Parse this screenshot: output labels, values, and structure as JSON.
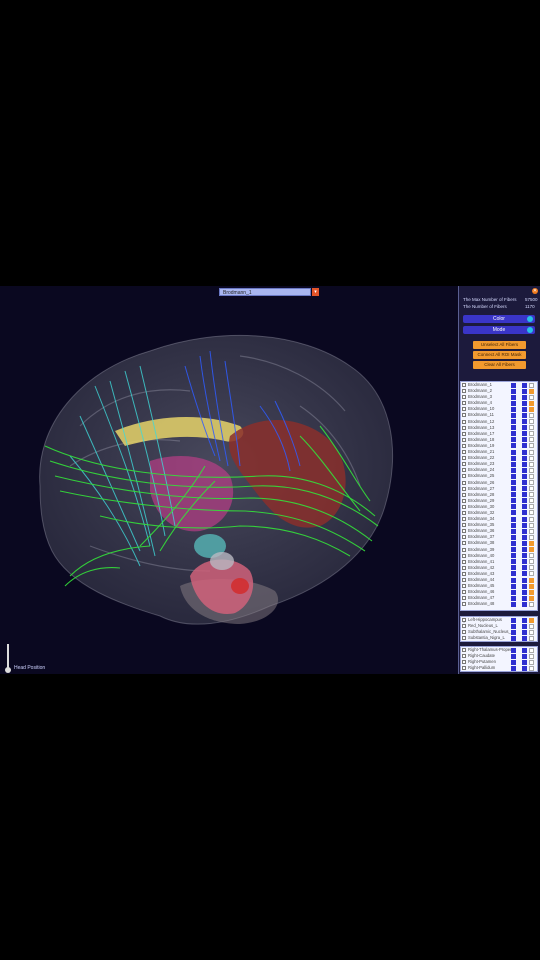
{
  "viewer": {
    "region_selector": {
      "value": "Brodmann_1"
    },
    "head_position_label": "Head Position"
  },
  "panel": {
    "stats": [
      {
        "label": "The Max Number of Fibers",
        "value": "57500"
      },
      {
        "label": "The Number of Fibers",
        "value": "1170"
      }
    ],
    "color_button": "Color",
    "mode_button": "Mode",
    "unselect_all": "Unselect All Fibers",
    "connect_btn": "Connect All ROI Mask",
    "clear_all": "Clear All Fibers",
    "brodmann_rows": [
      {
        "label": "Brodmann_1",
        "checked": false,
        "highlight": false
      },
      {
        "label": "Brodmann_2",
        "checked": false,
        "highlight": true
      },
      {
        "label": "Brodmann_3",
        "checked": false,
        "highlight": false
      },
      {
        "label": "Brodmann_4",
        "checked": false,
        "highlight": true
      },
      {
        "label": "Brodmann_10",
        "checked": false,
        "highlight": true
      },
      {
        "label": "Brodmann_11",
        "checked": false,
        "highlight": false
      },
      {
        "label": "Brodmann_12",
        "checked": false,
        "highlight": false
      },
      {
        "label": "Brodmann_13",
        "checked": false,
        "highlight": false
      },
      {
        "label": "Brodmann_17",
        "checked": false,
        "highlight": false
      },
      {
        "label": "Brodmann_18",
        "checked": false,
        "highlight": false
      },
      {
        "label": "Brodmann_19",
        "checked": false,
        "highlight": false
      },
      {
        "label": "Brodmann_21",
        "checked": false,
        "highlight": false
      },
      {
        "label": "Brodmann_22",
        "checked": false,
        "highlight": false
      },
      {
        "label": "Brodmann_23",
        "checked": false,
        "highlight": false
      },
      {
        "label": "Brodmann_24",
        "checked": false,
        "highlight": false
      },
      {
        "label": "Brodmann_25",
        "checked": false,
        "highlight": false
      },
      {
        "label": "Brodmann_26",
        "checked": false,
        "highlight": false
      },
      {
        "label": "Brodmann_27",
        "checked": false,
        "highlight": false
      },
      {
        "label": "Brodmann_28",
        "checked": false,
        "highlight": false
      },
      {
        "label": "Brodmann_29",
        "checked": false,
        "highlight": false
      },
      {
        "label": "Brodmann_30",
        "checked": false,
        "highlight": false
      },
      {
        "label": "Brodmann_32",
        "checked": false,
        "highlight": false
      },
      {
        "label": "Brodmann_34",
        "checked": false,
        "highlight": false
      },
      {
        "label": "Brodmann_35",
        "checked": false,
        "highlight": false
      },
      {
        "label": "Brodmann_36",
        "checked": false,
        "highlight": false
      },
      {
        "label": "Brodmann_37",
        "checked": false,
        "highlight": false
      },
      {
        "label": "Brodmann_38",
        "checked": false,
        "highlight": true
      },
      {
        "label": "Brodmann_39",
        "checked": false,
        "highlight": true
      },
      {
        "label": "Brodmann_40",
        "checked": false,
        "highlight": false
      },
      {
        "label": "Brodmann_41",
        "checked": false,
        "highlight": false
      },
      {
        "label": "Brodmann_42",
        "checked": false,
        "highlight": false
      },
      {
        "label": "Brodmann_43",
        "checked": false,
        "highlight": false
      },
      {
        "label": "Brodmann_44",
        "checked": false,
        "highlight": true
      },
      {
        "label": "Brodmann_45",
        "checked": false,
        "highlight": true
      },
      {
        "label": "Brodmann_46",
        "checked": false,
        "highlight": true
      },
      {
        "label": "Brodmann_47",
        "checked": false,
        "highlight": true
      },
      {
        "label": "Brodmann_48",
        "checked": false,
        "highlight": false
      }
    ],
    "left_rows": [
      {
        "label": "Left-Hippocampus",
        "checked": true,
        "highlight": true
      },
      {
        "label": "Red_Nucleus_L",
        "checked": false,
        "highlight": false
      },
      {
        "label": "Subthalamic_Nucleus_L",
        "checked": false,
        "highlight": false
      },
      {
        "label": "Substantia_Nigra_L",
        "checked": false,
        "highlight": false
      }
    ],
    "right_rows": [
      {
        "label": "Right-Thalamus-Proper",
        "checked": false,
        "highlight": false
      },
      {
        "label": "Right-Caudate",
        "checked": false,
        "highlight": false
      },
      {
        "label": "Right-Putamen",
        "checked": false,
        "highlight": false
      },
      {
        "label": "Right-Pallidum",
        "checked": false,
        "highlight": false
      }
    ]
  },
  "colors": {
    "background": "#0a0820",
    "panel": "#1c1a3c",
    "accent_blue": "#3a35c8",
    "accent_orange": "#f29a2e",
    "fiber_green": "#34e03a",
    "fiber_cyan": "#3fd8d8",
    "fiber_blue": "#2f5cff"
  }
}
